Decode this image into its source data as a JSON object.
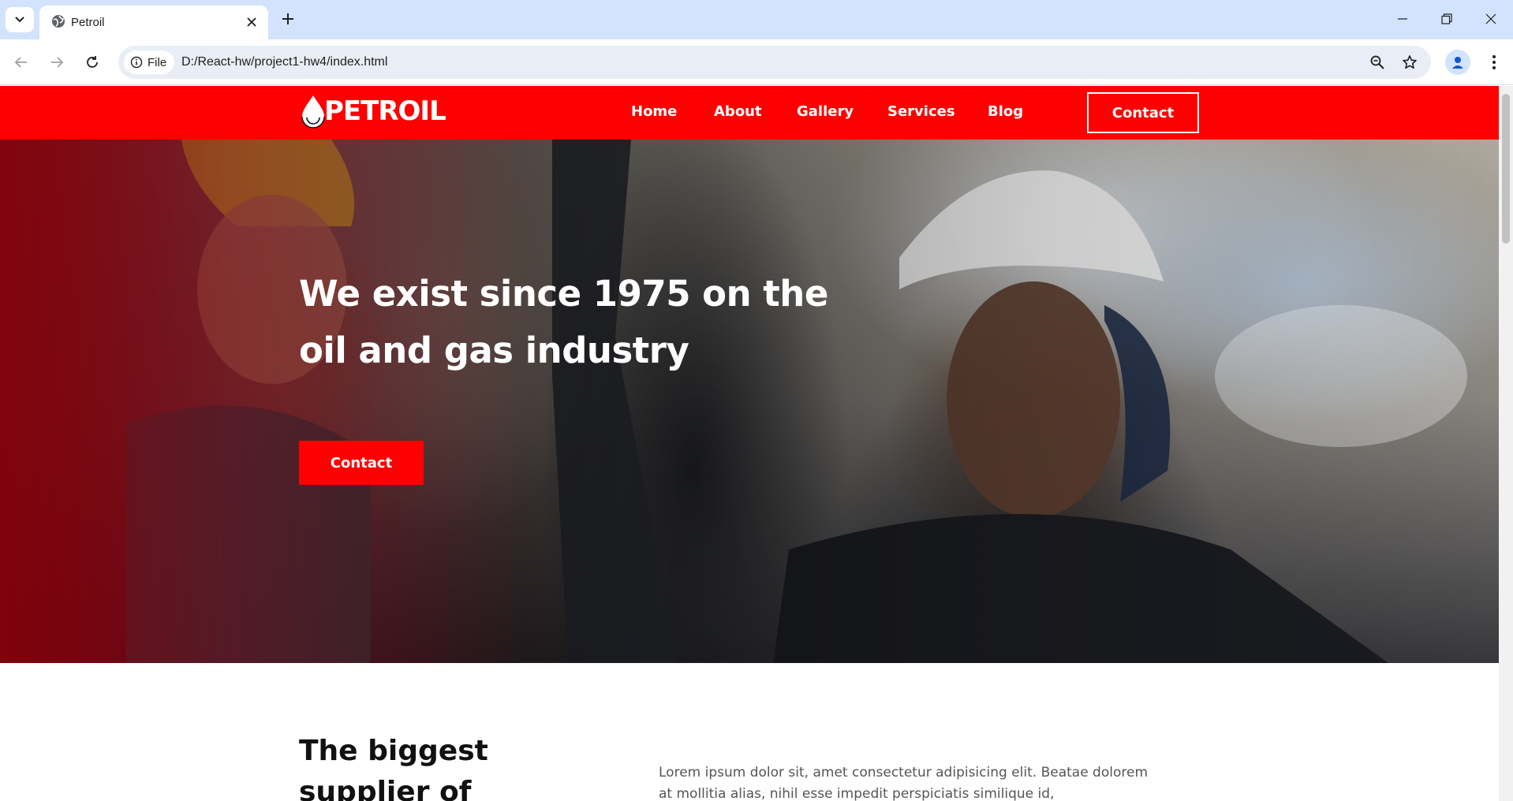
{
  "browser": {
    "tab_title": "Petroil",
    "file_chip_label": "File",
    "url": "D:/React-hw/project1-hw4/index.html",
    "icons": [
      "tab-list-icon",
      "globe-icon",
      "close-icon",
      "plus-icon",
      "minimize-icon",
      "restore-icon",
      "window-close-icon",
      "back-arrow-icon",
      "forward-arrow-icon",
      "reload-icon",
      "info-icon",
      "zoom-icon",
      "star-icon",
      "profile-icon",
      "more-vert-icon"
    ]
  },
  "site": {
    "logo_text": "PETROIL",
    "nav": {
      "home": "Home",
      "about": "About",
      "gallery": "Gallery",
      "services": "Services",
      "blog": "Blog",
      "contact": "Contact"
    },
    "hero": {
      "title": "We exist since 1975 on the oil and gas industry",
      "button": "Contact"
    },
    "about": {
      "heading": "The biggest supplier of",
      "text": "Lorem ipsum dolor sit, amet consectetur adipisicing elit. Beatae dolorem at mollitia alias, nihil esse impedit perspiciatis similique id,"
    },
    "colors": {
      "brand_red": "#ff0000",
      "white": "#ffffff"
    }
  }
}
